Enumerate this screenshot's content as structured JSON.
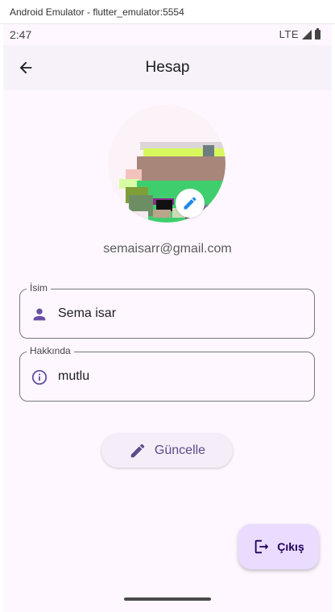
{
  "window": {
    "title": "Android Emulator - flutter_emulator:5554"
  },
  "status_bar": {
    "time": "2:47",
    "network": "LTE"
  },
  "app_bar": {
    "title": "Hesap"
  },
  "profile": {
    "email": "semaisarr@gmail.com"
  },
  "fields": [
    {
      "label": "İsim",
      "value": "Sema isar",
      "icon": "person-icon"
    },
    {
      "label": "Hakkında",
      "value": "mutlu",
      "icon": "info-icon"
    }
  ],
  "actions": {
    "update_label": "Güncelle",
    "logout_label": "Çıkış"
  },
  "colors": {
    "accent": "#6750a4",
    "fab_bg": "#eadcff",
    "surface": "#fef7ff",
    "app_bar": "#f7f2fa",
    "edit_icon": "#1e88e5"
  }
}
